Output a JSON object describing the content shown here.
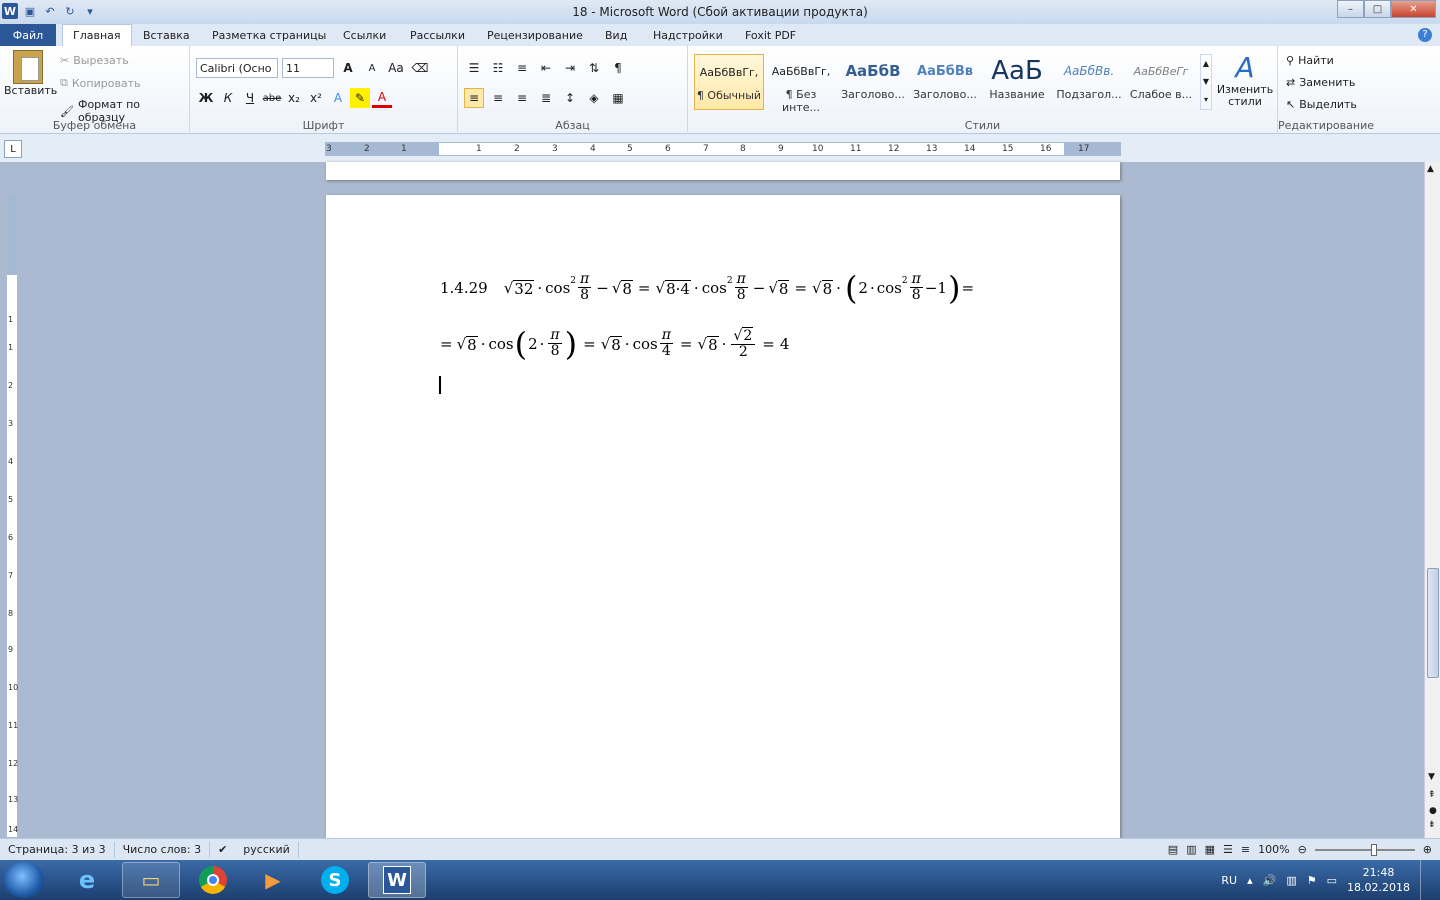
{
  "window": {
    "title": "18 - Microsoft Word (Сбой активации продукта)",
    "min": "–",
    "max": "□",
    "close": "✕"
  },
  "tabs": {
    "file": "Файл",
    "items": [
      "Главная",
      "Вставка",
      "Разметка страницы",
      "Ссылки",
      "Рассылки",
      "Рецензирование",
      "Вид",
      "Надстройки",
      "Foxit PDF"
    ],
    "help": "?"
  },
  "clipboard": {
    "paste": "Вставить",
    "cut": "Вырезать",
    "copy": "Копировать",
    "format": "Формат по образцу",
    "label": "Буфер обмена"
  },
  "font": {
    "name": "Calibri (Осно",
    "size": "11",
    "label": "Шрифт",
    "grow": "A",
    "shrink": "A",
    "case": "Aa",
    "bold": "Ж",
    "italic": "К",
    "underline": "Ч",
    "strike": "abe",
    "sub": "x₂",
    "sup": "x²"
  },
  "paragraph": {
    "label": "Абзац",
    "pilcrow": "¶"
  },
  "styles": {
    "label": "Стили",
    "items": [
      {
        "preview": "АаБбВвГг,",
        "name": "¶ Обычный"
      },
      {
        "preview": "АаБбВвГг,",
        "name": "¶ Без инте..."
      },
      {
        "preview": "АаБбВ",
        "name": "Заголово..."
      },
      {
        "preview": "АаБбВв",
        "name": "Заголово..."
      },
      {
        "preview": "АаБ",
        "name": "Название"
      },
      {
        "preview": "АаБбВв.",
        "name": "Подзагол..."
      },
      {
        "preview": "АаБбВеГг",
        "name": "Слабое в..."
      }
    ],
    "change": "Изменить стили"
  },
  "editing": {
    "label": "Редактирование",
    "find": "Найти",
    "replace": "Заменить",
    "select": "Выделить"
  },
  "ruler": {
    "numbers": [
      "3",
      "2",
      "1",
      "1",
      "2",
      "3",
      "4",
      "5",
      "6",
      "7",
      "8",
      "9",
      "10",
      "11",
      "12",
      "13",
      "14",
      "15",
      "16",
      "17"
    ],
    "vnumbers": [
      "1",
      "1",
      "2",
      "3",
      "4",
      "5",
      "6",
      "7",
      "8",
      "9",
      "10",
      "11",
      "12",
      "13",
      "14"
    ]
  },
  "document": {
    "problem": "1.4.29",
    "line1": {
      "a": "32",
      "cos": "cos",
      "pi": "π",
      "d": "8",
      "m": "−",
      "eq": "=",
      "r8": "8",
      "r84": "8·4",
      "dot": "·",
      "two": "2",
      "one": "1",
      "sq": "2"
    },
    "line2": {
      "eq": "=",
      "r8": "8",
      "cos": "cos",
      "two": "2",
      "pi": "π",
      "d8": "8",
      "d4": "4",
      "r2": "2",
      "res": "4"
    }
  },
  "status": {
    "page": "Страница: 3 из 3",
    "words": "Число слов: 3",
    "lang": "русский",
    "zoom": "100%"
  },
  "taskbar": {
    "lang": "RU",
    "time": "21:48",
    "date": "18.02.2018"
  }
}
